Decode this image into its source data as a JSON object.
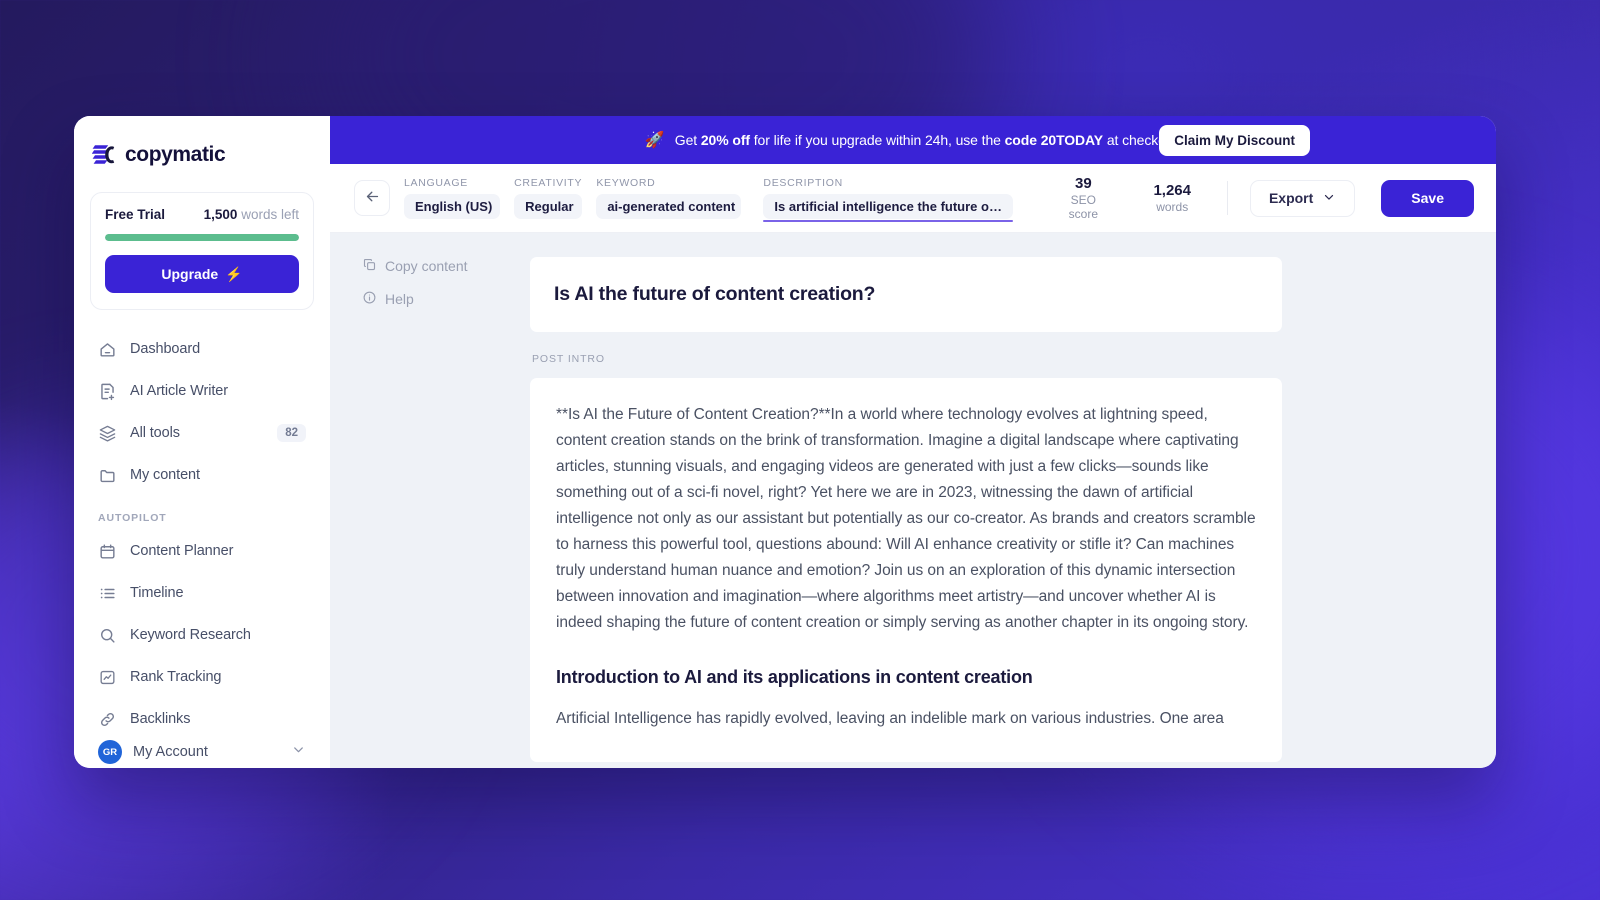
{
  "brand": {
    "name": "copymatic",
    "accent": "#3a23d6",
    "progress_color": "#5cbd8e"
  },
  "sidebar": {
    "trial": {
      "plan_label": "Free Trial",
      "words_number": "1,500",
      "words_suffix": "words left",
      "progress_percent": 100,
      "upgrade_label": "Upgrade",
      "upgrade_icon": "bolt-icon"
    },
    "items": [
      {
        "label": "Dashboard",
        "icon": "home-icon",
        "badge": ""
      },
      {
        "label": "AI Article Writer",
        "icon": "document-add-icon",
        "badge": ""
      },
      {
        "label": "All tools",
        "icon": "layers-icon",
        "badge": "82"
      },
      {
        "label": "My content",
        "icon": "folder-icon",
        "badge": ""
      }
    ],
    "section_label": "AUTOPILOT",
    "autopilot_items": [
      {
        "label": "Content Planner",
        "icon": "calendar-icon",
        "badge": ""
      },
      {
        "label": "Timeline",
        "icon": "list-icon",
        "badge": ""
      },
      {
        "label": "Keyword Research",
        "icon": "search-icon",
        "badge": ""
      },
      {
        "label": "Rank Tracking",
        "icon": "chart-box-icon",
        "badge": ""
      },
      {
        "label": "Backlinks",
        "icon": "link-icon",
        "badge": ""
      }
    ],
    "account": {
      "label": "My Account",
      "initials": "GR",
      "chevron_icon": "chevron-down-icon"
    }
  },
  "promo": {
    "icon": "rocket-icon",
    "prefix": "Get ",
    "discount": "20% off",
    "middle": " for life if you upgrade within 24h, use the ",
    "code": "code 20TODAY",
    "suffix": " at checkout!",
    "cta_label": "Claim My Discount"
  },
  "toolbar": {
    "back_icon": "arrow-left-icon",
    "fields": [
      {
        "label": "LANGUAGE",
        "value": "English (US)"
      },
      {
        "label": "CREATIVITY",
        "value": "Regular"
      },
      {
        "label": "KEYWORD",
        "value": "ai-generated content"
      }
    ],
    "description": {
      "label": "DESCRIPTION",
      "value": "Is artificial intelligence the future of con…"
    },
    "stats": [
      {
        "value": "39",
        "label": "SEO score"
      },
      {
        "value": "1,264",
        "label": "words"
      }
    ],
    "export_label": "Export",
    "export_icon": "chevron-down-icon",
    "save_label": "Save"
  },
  "side_actions": [
    {
      "label": "Copy content",
      "icon": "copy-icon"
    },
    {
      "label": "Help",
      "icon": "info-icon"
    }
  ],
  "document": {
    "title": "Is AI the future of content creation?",
    "section_tag": "POST INTRO",
    "intro": "**Is AI the Future of Content Creation?**In a world where technology evolves at lightning speed, content creation stands on the brink of transformation. Imagine a digital landscape where captivating articles, stunning visuals, and engaging videos are generated with just a few clicks—sounds like something out of a sci-fi novel, right? Yet here we are in 2023, witnessing the dawn of artificial intelligence not only as our assistant but potentially as our co-creator. As brands and creators scramble to harness this powerful tool, questions abound: Will AI enhance creativity or stifle it? Can machines truly understand human nuance and emotion? Join us on an exploration of this dynamic intersection between innovation and imagination—where algorithms meet artistry—and uncover whether AI is indeed shaping the future of content creation or simply serving as another chapter in its ongoing story.",
    "heading_1": "Introduction to AI and its applications in content creation",
    "paragraph_1": "Artificial Intelligence has rapidly evolved, leaving an indelible mark on various industries. One area"
  }
}
